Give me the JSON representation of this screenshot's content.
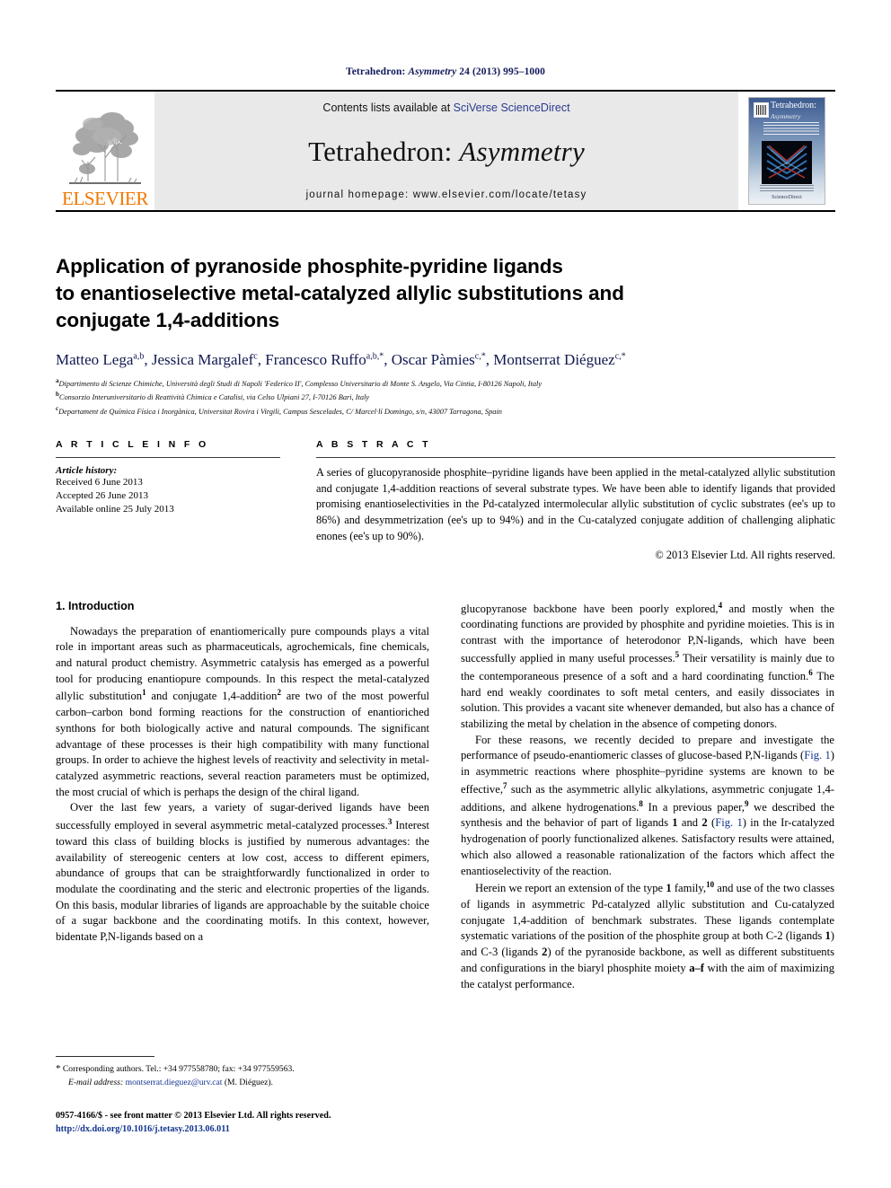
{
  "running_head": {
    "journal_name": "Tetrahedron: ",
    "journal_name_italic": "Asymmetry",
    "citation": " 24 (2013) 995–1000"
  },
  "masthead": {
    "publisher_logo": "elsevier-logo",
    "publisher_name": "ELSEVIER",
    "contents_prefix": "Contents lists available at ",
    "contents_link": "SciVerse ScienceDirect",
    "journal_title_main": "Tetrahedron: ",
    "journal_title_italic": "Asymmetry",
    "homepage": "journal homepage: www.elsevier.com/locate/tetasy",
    "cover": {
      "title": "Tetrahedron:",
      "subtitle": "Asymmetry",
      "brand": "ScienceDirect"
    }
  },
  "article": {
    "title_lines": [
      "Application of pyranoside phosphite-pyridine ligands",
      "to enantioselective metal-catalyzed allylic substitutions and",
      "conjugate 1,4-additions"
    ],
    "authors": [
      {
        "name": "Matteo Lega",
        "marks": "a,b",
        "sep": ", "
      },
      {
        "name": "Jessica Margalef",
        "marks": "c",
        "sep": ", "
      },
      {
        "name": "Francesco Ruffo",
        "marks": "a,b,*",
        "sep": ", "
      },
      {
        "name": "Oscar Pàmies",
        "marks": "c,*",
        "sep": ", "
      },
      {
        "name": "Montserrat Diéguez",
        "marks": "c,*",
        "sep": ""
      }
    ],
    "affiliations": [
      {
        "mark": "a",
        "text": "Dipartimento di Scienze Chimiche, Università degli Studi di Napoli 'Federico II', Complesso Universitario di Monte S. Angelo, Via Cintia, I-80126 Napoli, Italy"
      },
      {
        "mark": "b",
        "text": "Consorzio Interuniversitario di Reattività Chimica e Catalisi, via Celso Ulpiani 27, I-70126 Bari, Italy"
      },
      {
        "mark": "c",
        "text": "Departament de Química Física i Inorgànica, Universitat Rovira i Virgili, Campus Sescelades, C/ Marcel·lí Domingo, s/n, 43007 Tarragona, Spain"
      }
    ]
  },
  "article_info": {
    "heading": "A R T I C L E   I N F O",
    "history_label": "Article history:",
    "history": [
      "Received 6 June 2013",
      "Accepted 26 June 2013",
      "Available online 25 July 2013"
    ]
  },
  "abstract": {
    "heading": "A B S T R A C T",
    "text": "A series of glucopyranoside phosphite–pyridine ligands have been applied in the metal-catalyzed allylic substitution and conjugate 1,4-addition reactions of several substrate types. We have been able to identify ligands that provided promising enantioselectivities in the Pd-catalyzed intermolecular allylic substitution of cyclic substrates (ee's up to 86%) and desymmetrization (ee's up to 94%) and in the Cu-catalyzed conjugate addition of challenging aliphatic enones (ee's up to 90%).",
    "copyright": "© 2013 Elsevier Ltd. All rights reserved."
  },
  "introduction": {
    "heading": "1. Introduction",
    "left_paragraphs": [
      "Nowadays the preparation of enantiomerically pure compounds plays a vital role in important areas such as pharmaceuticals, agrochemicals, fine chemicals, and natural product chemistry. Asymmetric catalysis has emerged as a powerful tool for producing enantiopure compounds. In this respect the metal-catalyzed allylic substitution|1| and conjugate 1,4-addition|2| are two of the most powerful carbon–carbon bond forming reactions for the construction of enantioriched synthons for both biologically active and natural compounds. The significant advantage of these processes is their high compatibility with many functional groups. In order to achieve the highest levels of reactivity and selectivity in metal-catalyzed asymmetric reactions, several reaction parameters must be optimized, the most crucial of which is perhaps the design of the chiral ligand.",
      "Over the last few years, a variety of sugar-derived ligands have been successfully employed in several asymmetric metal-catalyzed processes.|3| Interest toward this class of building blocks is justified by numerous advantages: the availability of stereogenic centers at low cost, access to different epimers, abundance of groups that can be straightforwardly functionalized in order to modulate the coordinating and the steric and electronic properties of the ligands. On this basis, modular libraries of ligands are approachable by the suitable choice of a sugar backbone and the coordinating motifs. In this context, however, bidentate P,N-ligands based on a"
    ],
    "right_paragraphs": [
      "glucopyranose backbone have been poorly explored,|4| and mostly when the coordinating functions are provided by phosphite and pyridine moieties. This is in contrast with the importance of heterodonor P,N-ligands, which have been successfully applied in many useful processes.|5| Their versatility is mainly due to the contemporaneous presence of a soft and a hard coordinating function.|6| The hard end weakly coordinates to soft metal centers, and easily dissociates in solution. This provides a vacant site whenever demanded, but also has a chance of stabilizing the metal by chelation in the absence of competing donors.",
      "For these reasons, we recently decided to prepare and investigate the performance of pseudo-enantiomeric classes of glucose-based P,N-ligands (Fig. 1) in asymmetric reactions where phosphite–pyridine systems are known to be effective,|7| such as the asymmetric allylic alkylations, asymmetric conjugate 1,4-additions, and alkene hydrogenations.|8| In a previous paper,|9| we described the synthesis and the behavior of part of ligands 1 and 2 (Fig. 1) in the Ir-catalyzed hydrogenation of poorly functionalized alkenes. Satisfactory results were attained, which also allowed a reasonable rationalization of the factors which affect the enantioselectivity of the reaction.",
      "Herein we report an extension of the type 1 family,|10| and use of the two classes of ligands in asymmetric Pd-catalyzed allylic substitution and Cu-catalyzed conjugate 1,4-addition of benchmark substrates. These ligands contemplate systematic variations of the position of the phosphite group at both C-2 (ligands 1) and C-3 (ligands 2) of the pyranoside backbone, as well as different substituents and configurations in the biaryl phosphite moiety a–f with the aim of maximizing the catalyst performance."
    ]
  },
  "footnote": {
    "star": "*",
    "corresponding": " Corresponding authors. Tel.: +34 977558780; fax: +34 977559563.",
    "email_label": "E-mail address:",
    "email": "montserrat.dieguez@urv.cat",
    "email_suffix": " (M. Diéguez)."
  },
  "imprint": {
    "line1": "0957-4166/$ - see front matter © 2013 Elsevier Ltd. All rights reserved.",
    "doi": "http://dx.doi.org/10.1016/j.tetasy.2013.06.011"
  },
  "colors": {
    "link": "#11348f",
    "running_head": "#11195c",
    "author": "#10184f",
    "elsevier_orange": "#f07800",
    "masthead_bg": "#e9e9e9"
  }
}
